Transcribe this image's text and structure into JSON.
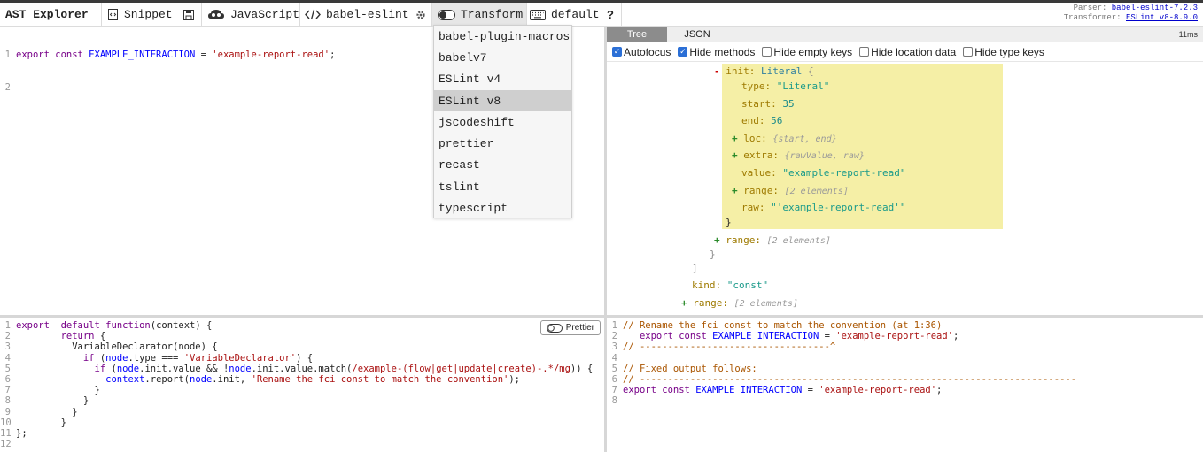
{
  "topbar": {
    "brand": "AST Explorer",
    "snippet_label": "Snippet",
    "language_label": "JavaScript",
    "parser_label": "babel-eslint",
    "transform_label": "Transform",
    "keymap_label": "default",
    "help_label": "?",
    "parser_info_label": "Parser:",
    "parser_info_value": "babel-eslint-7.2.3",
    "transformer_info_label": "Transformer:",
    "transformer_info_value": "ESLint v8-8.9.0"
  },
  "transform_menu": {
    "items": [
      "babel-plugin-macros",
      "babelv7",
      "ESLint v4",
      "ESLint v8",
      "jscodeshift",
      "prettier",
      "recast",
      "tslint",
      "typescript"
    ],
    "selected": "ESLint v8"
  },
  "source_code": {
    "line_numbers": [
      "1",
      "2"
    ],
    "line1": {
      "kw1": "export",
      "kw2": "const",
      "name": "EXAMPLE_INTERACTION",
      "eq": "=",
      "str": "'example-report-read'",
      "end": ";"
    }
  },
  "ast_panel": {
    "tabs": [
      "Tree",
      "JSON"
    ],
    "active_tab": "Tree",
    "time": "11ms",
    "options": [
      {
        "label": "Autofocus",
        "checked": true
      },
      {
        "label": "Hide methods",
        "checked": true
      },
      {
        "label": "Hide empty keys",
        "checked": false
      },
      {
        "label": "Hide location data",
        "checked": false
      },
      {
        "label": "Hide type keys",
        "checked": false
      }
    ],
    "nodes": {
      "init_key": "init:",
      "init_type": "Literal",
      "open_brace": "{",
      "type_key": "type:",
      "type_val": "\"Literal\"",
      "start_key": "start:",
      "start_val": "35",
      "end_key": "end:",
      "end_val": "56",
      "loc_key": "loc:",
      "loc_sum": "{start, end}",
      "extra_key": "extra:",
      "extra_sum": "{rawValue, raw}",
      "value_key": "value:",
      "value_val": "\"example-report-read\"",
      "range_key": "range:",
      "range_sum": "[2 elements]",
      "raw_key": "raw:",
      "raw_val": "\"'example-report-read'\"",
      "close_brace": "}",
      "range2_key": "range:",
      "range2_sum": "[2 elements]",
      "close_brace2": "}",
      "close_bracket": "]",
      "kind_key": "kind:",
      "kind_val": "\"const\"",
      "range3_key": "range:",
      "range3_sum": "[2 elements]"
    }
  },
  "transform_code": {
    "prettier_label": "Prettier",
    "lines": [
      {
        "n": "1",
        "parts": [
          [
            "kw",
            "export"
          ],
          [
            "",
            "  "
          ],
          [
            "kw",
            "default"
          ],
          [
            "",
            ""
          ],
          [
            "kw",
            " function"
          ],
          [
            "",
            "(context) {"
          ]
        ]
      },
      {
        "n": "2",
        "parts": [
          [
            "",
            "        "
          ],
          [
            "kw",
            "return"
          ],
          [
            "",
            " {"
          ]
        ]
      },
      {
        "n": "3",
        "parts": [
          [
            "",
            "          VariableDeclarator(node) {"
          ]
        ]
      },
      {
        "n": "4",
        "parts": [
          [
            "",
            "            "
          ],
          [
            "kw",
            "if"
          ],
          [
            "",
            " ("
          ],
          [
            "def",
            "node"
          ],
          [
            "",
            ".type === "
          ],
          [
            "str",
            "'VariableDeclarator'"
          ],
          [
            "",
            ") {"
          ]
        ]
      },
      {
        "n": "5",
        "parts": [
          [
            "",
            "              "
          ],
          [
            "kw",
            "if"
          ],
          [
            "",
            " ("
          ],
          [
            "def",
            "node"
          ],
          [
            "",
            ".init.value && !"
          ],
          [
            "def",
            "node"
          ],
          [
            "",
            ".init.value.match("
          ],
          [
            "str",
            "/example-(flow|get|update|create)-.*/mg"
          ],
          [
            "",
            ")) {"
          ]
        ]
      },
      {
        "n": "6",
        "parts": [
          [
            "",
            "                "
          ],
          [
            "def",
            "context"
          ],
          [
            "",
            ".report("
          ],
          [
            "def",
            "node"
          ],
          [
            "",
            ".init, "
          ],
          [
            "str",
            "'Rename the fci const to match the convention'"
          ],
          [
            "",
            ");"
          ]
        ]
      },
      {
        "n": "7",
        "parts": [
          [
            "",
            "              }"
          ]
        ]
      },
      {
        "n": "8",
        "parts": [
          [
            "",
            "            }"
          ]
        ]
      },
      {
        "n": "9",
        "parts": [
          [
            "",
            "          }"
          ]
        ]
      },
      {
        "n": "10",
        "parts": [
          [
            "",
            "        }"
          ]
        ]
      },
      {
        "n": "11",
        "parts": [
          [
            "",
            "};"
          ]
        ]
      },
      {
        "n": "12",
        "parts": [
          [
            "",
            ""
          ]
        ]
      }
    ]
  },
  "output": {
    "lines": [
      {
        "n": "1",
        "parts": [
          [
            "cmt",
            "// Rename the fci const to match the convention (at 1:36)"
          ]
        ]
      },
      {
        "n": "2",
        "parts": [
          [
            "",
            "   "
          ],
          [
            "kw",
            "export"
          ],
          [
            "",
            " "
          ],
          [
            "kw",
            "const"
          ],
          [
            "",
            " "
          ],
          [
            "def",
            "EXAMPLE_INTERACTION"
          ],
          [
            "",
            " = "
          ],
          [
            "str",
            "'example-report-read'"
          ],
          [
            "",
            ";"
          ]
        ]
      },
      {
        "n": "3",
        "parts": [
          [
            "cmt",
            "// ----------------------------------^"
          ]
        ]
      },
      {
        "n": "4",
        "parts": [
          [
            "",
            ""
          ]
        ]
      },
      {
        "n": "5",
        "parts": [
          [
            "cmt",
            "// Fixed output follows:"
          ]
        ]
      },
      {
        "n": "6",
        "parts": [
          [
            "cmt",
            "// ------------------------------------------------------------------------------"
          ]
        ]
      },
      {
        "n": "7",
        "parts": [
          [
            "kw",
            "export"
          ],
          [
            "",
            " "
          ],
          [
            "kw",
            "const"
          ],
          [
            "",
            " "
          ],
          [
            "def",
            "EXAMPLE_INTERACTION"
          ],
          [
            "",
            " = "
          ],
          [
            "str",
            "'example-report-read'"
          ],
          [
            "",
            ";"
          ]
        ]
      },
      {
        "n": "8",
        "parts": [
          [
            "",
            ""
          ]
        ]
      }
    ]
  }
}
